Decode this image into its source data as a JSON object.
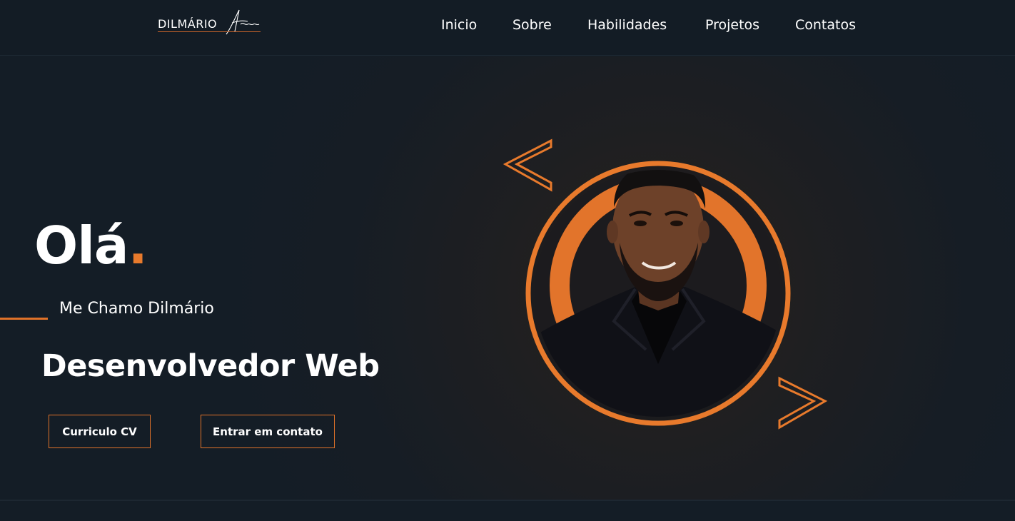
{
  "header": {
    "logo_text": "DILMÁRIO",
    "nav": [
      "Inicio",
      "Sobre",
      "Habilidades",
      "Projetos",
      "Contatos"
    ]
  },
  "hero": {
    "greeting": "Olá",
    "greeting_dot": ".",
    "intro": "Me Chamo Dilmário",
    "role": "Desenvolvedor Web",
    "buttons": {
      "cv": "Curriculo CV",
      "contact": "Entrar em contato"
    }
  },
  "colors": {
    "background": "#141d26",
    "accent": "#e87a2c",
    "text": "#ffffff"
  },
  "icons": [
    "signature-logo",
    "chevron-left-icon",
    "chevron-right-icon",
    "profile-photo"
  ]
}
